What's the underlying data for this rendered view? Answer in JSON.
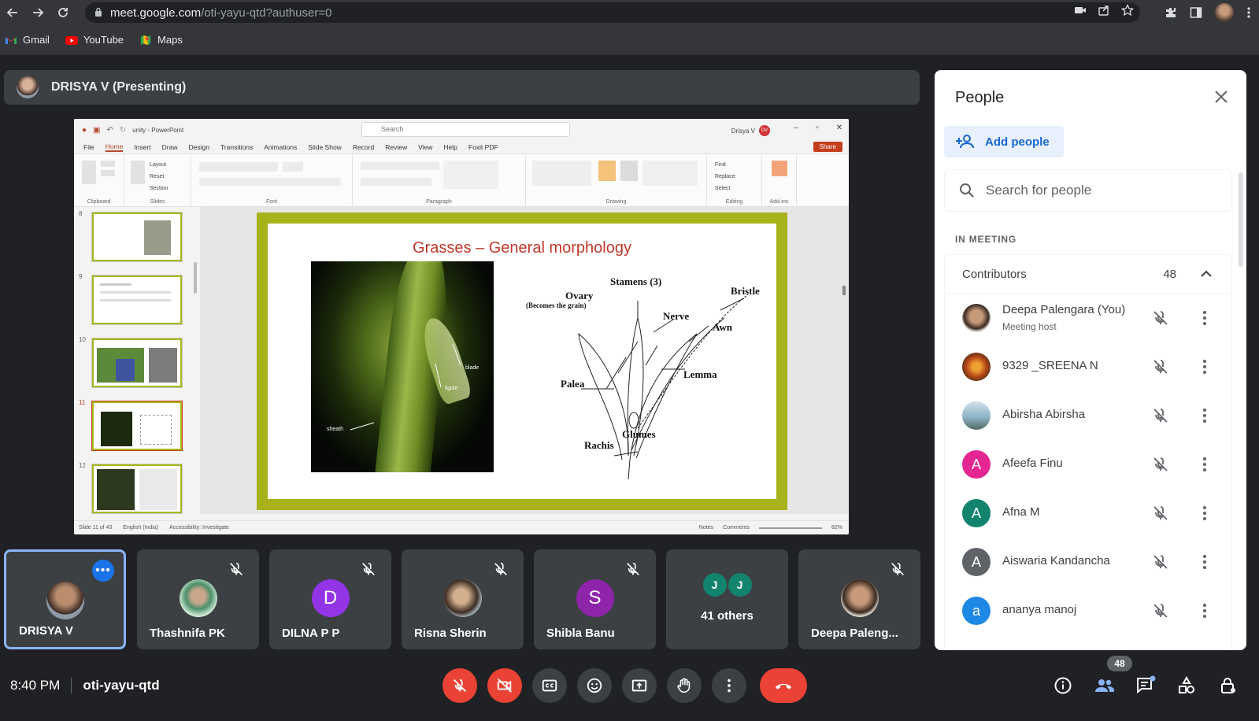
{
  "browser": {
    "url_host": "meet.google.com",
    "url_path": "/oti-yayu-qtd?authuser=0",
    "bookmarks": [
      {
        "label": "Gmail",
        "icon": "gmail-icon"
      },
      {
        "label": "YouTube",
        "icon": "youtube-icon"
      },
      {
        "label": "Maps",
        "icon": "maps-icon"
      }
    ]
  },
  "presenter": {
    "title": "DRISYA V (Presenting)"
  },
  "ppt": {
    "app_title": "unity  -  PowerPoint",
    "search": "Search",
    "user": "Drisya V",
    "user_initials": "DV",
    "menu": [
      "File",
      "Home",
      "Insert",
      "Draw",
      "Design",
      "Transitions",
      "Animations",
      "Slide Show",
      "Record",
      "Review",
      "View",
      "Help",
      "Foxit PDF"
    ],
    "share": "Share",
    "ribbon_groups": [
      "Clipboard",
      "Slides",
      "Font",
      "Paragraph",
      "Drawing",
      "Editing",
      "Add-ins"
    ],
    "ribbon_slides": [
      "Layout",
      "Reset",
      "Section"
    ],
    "ribbon_editing": [
      "Find",
      "Replace",
      "Select"
    ],
    "thumb_numbers": [
      "8",
      "9",
      "10",
      "11",
      "12"
    ],
    "slide": {
      "title": "Grasses – General morphology",
      "photo_labels": {
        "blade": "blade",
        "ligule": "ligule",
        "sheath": "sheath"
      },
      "diagram_labels": {
        "stamens": "Stamens  (3)",
        "ovary": "Ovary",
        "ovary_note": "(Becomes  the  grain)",
        "bristle": "Bristle",
        "nerve": "Nerve",
        "awn": "Awn",
        "palea": "Palea",
        "lemma": "Lemma",
        "glumes": "Glumes",
        "rachis": "Rachis"
      }
    },
    "status": {
      "slide_of": "Slide 11 of 43",
      "lang": "English (India)",
      "access": "Accessibility: Investigate",
      "notes": "Notes",
      "comments": "Comments",
      "zoom": "82%"
    }
  },
  "tiles": [
    {
      "name": "DRISYA V",
      "initial": "",
      "color": "#5f6368",
      "muted": false,
      "active": true
    },
    {
      "name": "Thashnifa PK",
      "initial": "",
      "color": "#cfe8d4",
      "muted": true,
      "active": false
    },
    {
      "name": "DILNA P P",
      "initial": "D",
      "color": "#9334e6",
      "muted": true,
      "active": false
    },
    {
      "name": "Risna Sherin",
      "initial": "",
      "color": "#8a6a50",
      "muted": true,
      "active": false
    },
    {
      "name": "Shibla Banu",
      "initial": "S",
      "color": "#8e24aa",
      "muted": true,
      "active": false
    },
    {
      "name": "41 others",
      "initial": "",
      "color": "#12846e",
      "muted": false,
      "active": false
    },
    {
      "name": "Deepa Paleng...",
      "initial": "",
      "color": "#b98d6e",
      "muted": true,
      "active": false
    }
  ],
  "others_initials": [
    "J",
    "J"
  ],
  "panel": {
    "title": "People",
    "add_people": "Add people",
    "search_placeholder": "Search for people",
    "section": "IN MEETING",
    "contributors_label": "Contributors",
    "contributors_count": "48",
    "people": [
      {
        "name": "Deepa Palengara (You)",
        "sub": "Meeting host",
        "initial": "",
        "color": "#8a6a50"
      },
      {
        "name": "9329 _SREENA N",
        "sub": "",
        "initial": "",
        "color": "#c0541b"
      },
      {
        "name": "Abirsha Abirsha",
        "sub": "",
        "initial": "",
        "color": "#8fb3c8"
      },
      {
        "name": "Afeefa Finu",
        "sub": "",
        "initial": "A",
        "color": "#e52592"
      },
      {
        "name": "Afna M",
        "sub": "",
        "initial": "A",
        "color": "#12846e"
      },
      {
        "name": "Aiswaria Kandancha",
        "sub": "",
        "initial": "A",
        "color": "#5f6368"
      },
      {
        "name": "ananya manoj",
        "sub": "",
        "initial": "a",
        "color": "#1e88e5"
      }
    ]
  },
  "bottom": {
    "time": "8:40 PM",
    "meeting_code": "oti-yayu-qtd",
    "people_badge": "48"
  },
  "colors": {
    "accent": "#8ab4f8",
    "danger": "#ea4335",
    "slide_border": "#a8b21a",
    "slide_title": "#c0392b"
  }
}
